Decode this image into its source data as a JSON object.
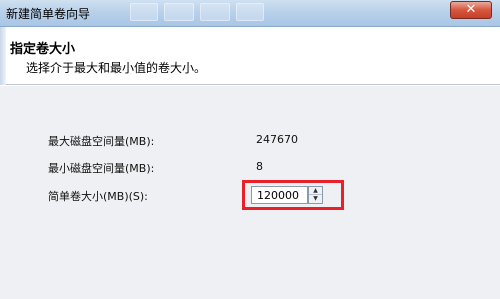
{
  "window": {
    "title": "新建简单卷向导",
    "close_glyph": "✕"
  },
  "header": {
    "title": "指定卷大小",
    "subtitle": "选择介于最大和最小值的卷大小。"
  },
  "fields": {
    "max_label": "最大磁盘空间量(MB):",
    "max_value": "247670",
    "min_label": "最小磁盘空间量(MB):",
    "min_value": "8",
    "size_label": "简单卷大小(MB)(S):",
    "size_value": "120000"
  },
  "spinner": {
    "up_glyph": "▲",
    "down_glyph": "▼"
  },
  "colors": {
    "highlight": "#e8202a"
  }
}
